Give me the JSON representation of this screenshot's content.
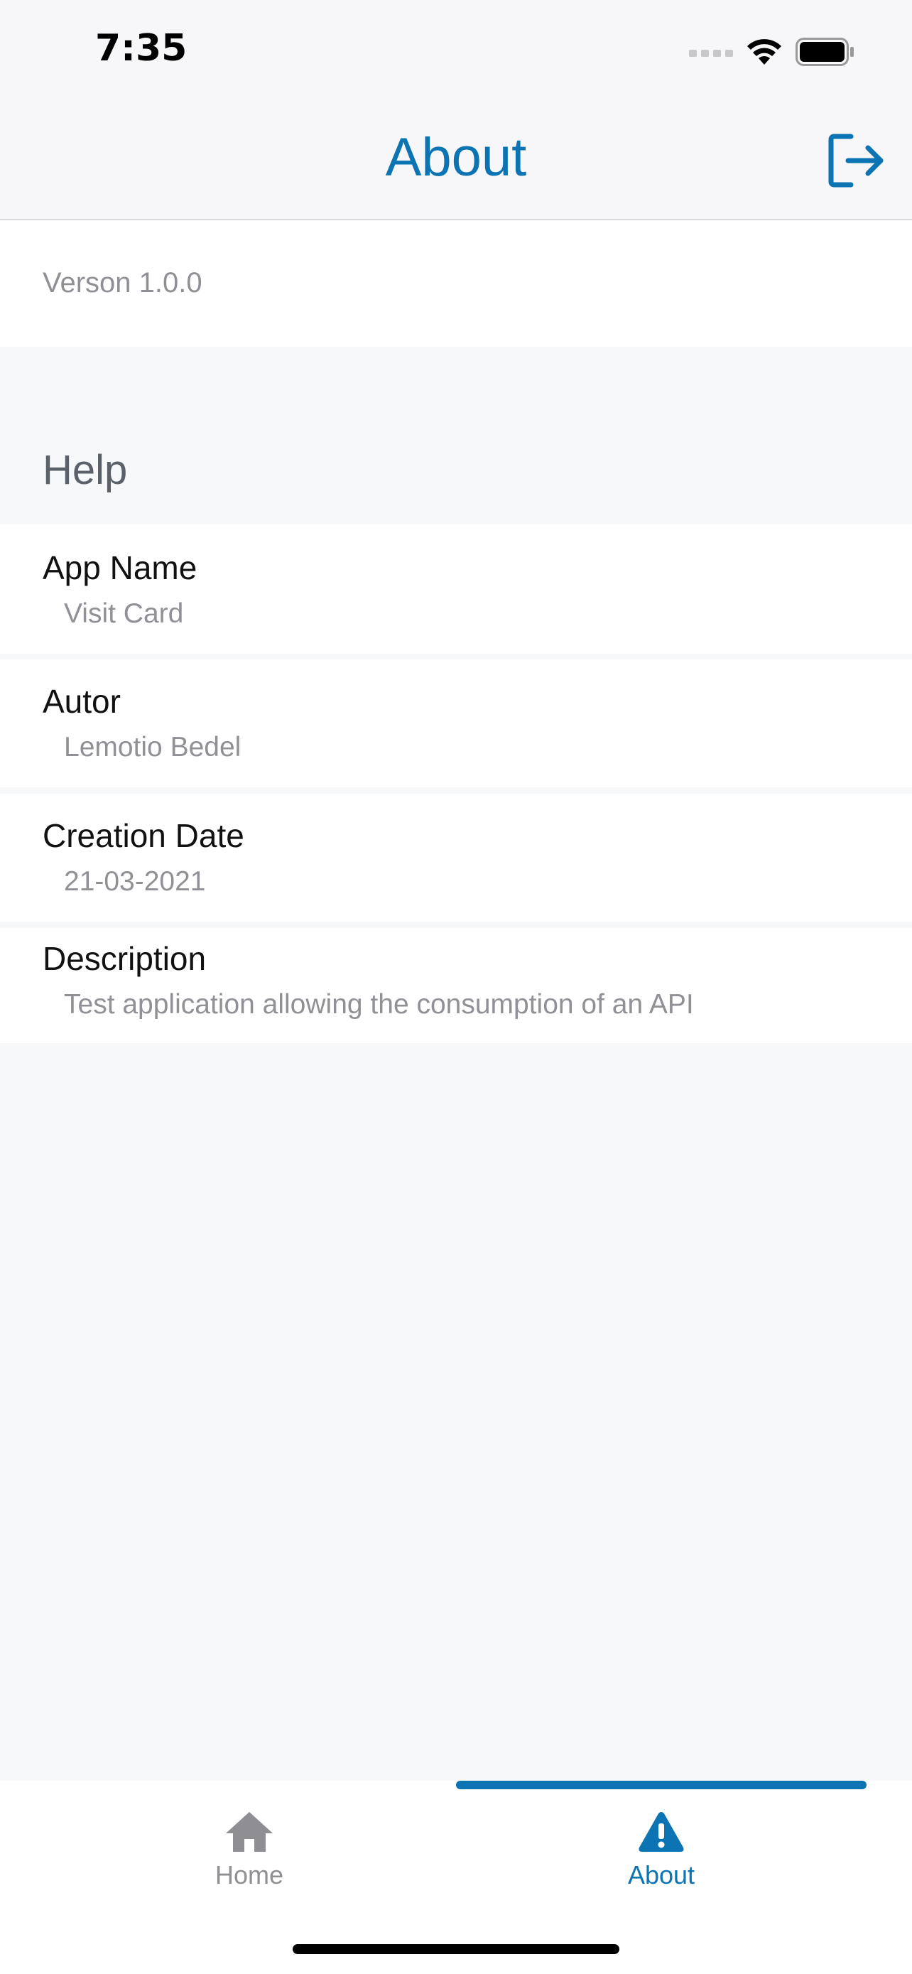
{
  "status_bar": {
    "time": "7:35"
  },
  "nav": {
    "title": "About",
    "logout_icon": "logout-icon"
  },
  "version": "Verson 1.0.0",
  "help": {
    "header": "Help",
    "items": [
      {
        "label": "App Name",
        "value": "Visit Card"
      },
      {
        "label": "Autor",
        "value": "Lemotio Bedel"
      },
      {
        "label": "Creation Date",
        "value": "21-03-2021"
      },
      {
        "label": "Description",
        "value": "Test application allowing the consumption of an API"
      }
    ]
  },
  "tabs": [
    {
      "label": "Home",
      "icon": "home-icon",
      "active": false
    },
    {
      "label": "About",
      "icon": "warning-icon",
      "active": true
    }
  ],
  "colors": {
    "accent": "#0c74b3",
    "inactive": "#8e8e93",
    "background": "#f7f8fa"
  }
}
